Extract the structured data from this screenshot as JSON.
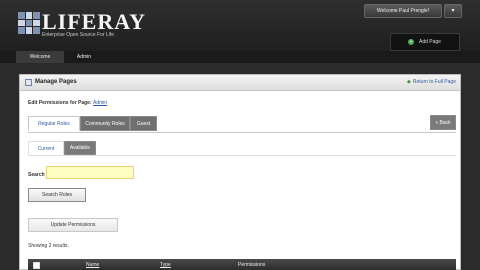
{
  "header": {
    "logo_text": "LIFERAY",
    "tagline": "Enterprise Open Source For Life",
    "welcome_label": "Welcome Paul Prengle!",
    "add_page_label": "Add Page"
  },
  "nav": {
    "tabs": [
      {
        "label": "Welcome"
      },
      {
        "label": "Admin"
      }
    ]
  },
  "portlet": {
    "title": "Manage Pages",
    "return_link": "Return to Full Page",
    "edit_permissions_prefix": "Edit Permissions for Page:",
    "page_name": "Admin",
    "role_tabs": [
      {
        "label": "Regular Roles"
      },
      {
        "label": "Community Roles"
      },
      {
        "label": "Guest"
      }
    ],
    "back_label": "« Back",
    "sub_tabs": [
      {
        "label": "Current"
      },
      {
        "label": "Available"
      }
    ],
    "search_label": "Search",
    "search_value": "",
    "search_button": "Search Roles",
    "update_button": "Update Permissions",
    "results_text": "Showing 2 results.",
    "table": {
      "columns": [
        "Name",
        "Type",
        "Permissions"
      ]
    }
  },
  "colors": {
    "accent_link": "#2c5aa0",
    "search_bg": "#fffcc2",
    "header_bg": "#1c1c1c"
  }
}
